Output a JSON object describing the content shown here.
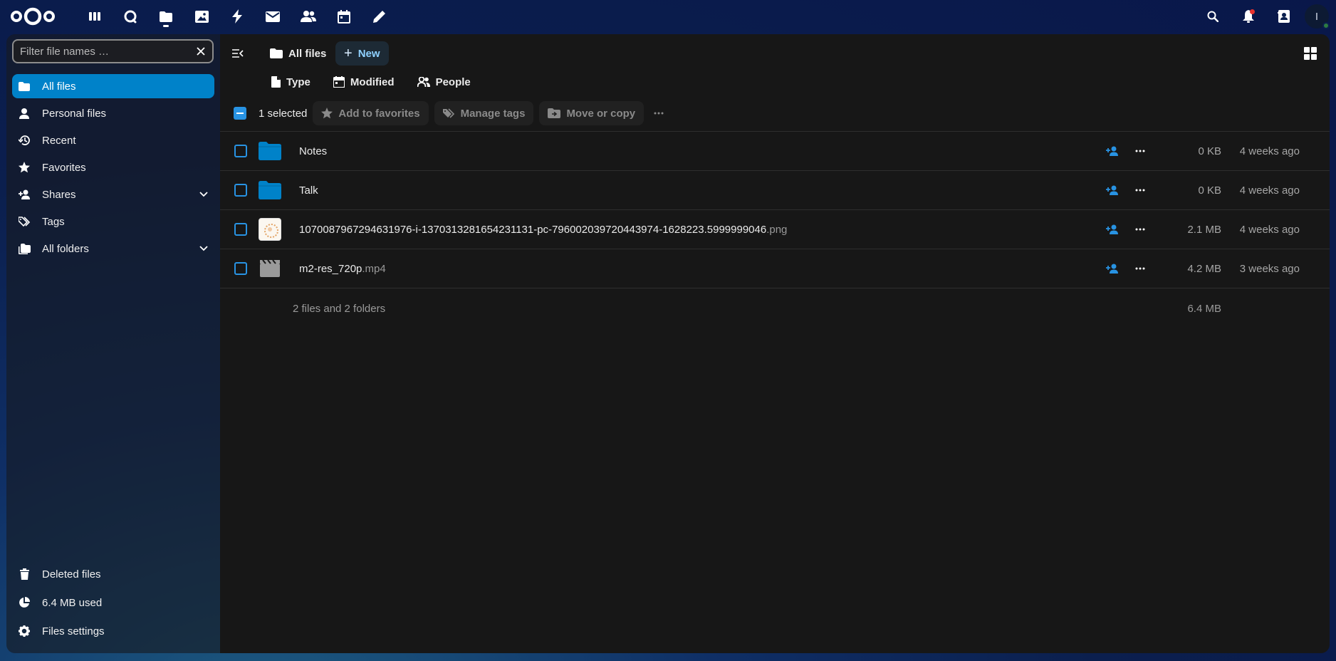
{
  "header": {
    "apps": [
      {
        "name": "dashboard",
        "icon": "dashboard-icon"
      },
      {
        "name": "talk",
        "icon": "talk-icon"
      },
      {
        "name": "files",
        "icon": "files-icon",
        "active": true
      },
      {
        "name": "photos",
        "icon": "photos-icon"
      },
      {
        "name": "activity",
        "icon": "activity-icon"
      },
      {
        "name": "mail",
        "icon": "mail-icon"
      },
      {
        "name": "contacts",
        "icon": "contacts-icon"
      },
      {
        "name": "calendar",
        "icon": "calendar-icon"
      },
      {
        "name": "notes",
        "icon": "pencil-icon"
      }
    ],
    "avatar_initial": "I",
    "accent_color": "#0082c9"
  },
  "sidebar": {
    "filter_placeholder": "Filter file names …",
    "items": [
      {
        "label": "All files",
        "icon": "folder-icon",
        "active": true
      },
      {
        "label": "Personal files",
        "icon": "person-icon"
      },
      {
        "label": "Recent",
        "icon": "history-icon"
      },
      {
        "label": "Favorites",
        "icon": "star-icon"
      },
      {
        "label": "Shares",
        "icon": "share-icon",
        "expandable": true
      },
      {
        "label": "Tags",
        "icon": "tags-icon"
      },
      {
        "label": "All folders",
        "icon": "folders-icon",
        "expandable": true
      }
    ],
    "bottom": {
      "trash": "Deleted files",
      "quota": "6.4 MB used",
      "settings": "Files settings"
    }
  },
  "toolbar": {
    "breadcrumb": "All files",
    "new_label": "New"
  },
  "filters": {
    "type": "Type",
    "modified": "Modified",
    "people": "People"
  },
  "selection": {
    "count_label": "1 selected",
    "add_favorites": "Add to favorites",
    "manage_tags": "Manage tags",
    "move_copy": "Move or copy"
  },
  "files": [
    {
      "name": "Notes",
      "ext": "",
      "kind": "folder",
      "size": "0 KB",
      "modified": "4 weeks ago"
    },
    {
      "name": "Talk",
      "ext": "",
      "kind": "folder",
      "size": "0 KB",
      "modified": "4 weeks ago"
    },
    {
      "name": "1070087967294631976-i-1370313281654231131-pc-796002039720443974-1628223.5999999046",
      "ext": ".png",
      "kind": "image",
      "size": "2.1 MB",
      "modified": "4 weeks ago"
    },
    {
      "name": "m2-res_720p",
      "ext": ".mp4",
      "kind": "video",
      "size": "4.2 MB",
      "modified": "3 weeks ago"
    }
  ],
  "summary": {
    "text": "2 files and 2 folders",
    "total": "6.4 MB"
  }
}
